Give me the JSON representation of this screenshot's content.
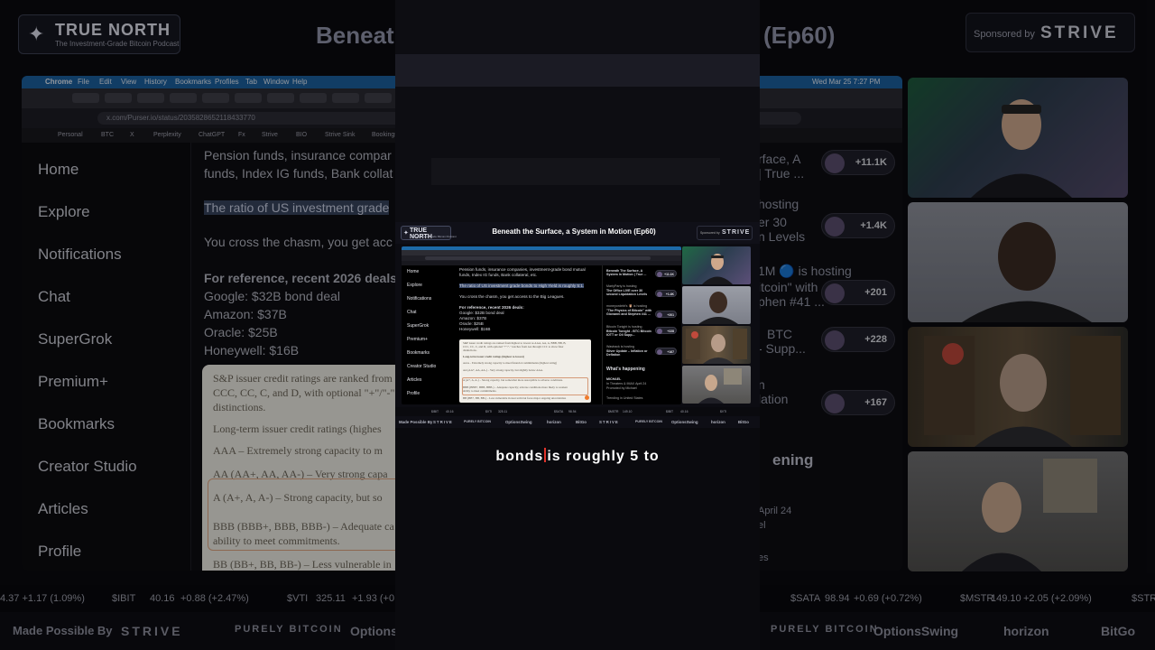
{
  "show": {
    "logo_title": "TRUE NORTH",
    "logo_subtitle": "The Investment-Grade Bitcoin Podcast",
    "episode_title": "Beneath the Surface, a System in Motion (Ep60)",
    "bg_title_left": "Beneath",
    "bg_title_right": "(Ep60)",
    "sponsored_by_label": "Sponsored by",
    "sponsor_brand": "STRIVE"
  },
  "browser": {
    "menu": [
      "Chrome",
      "File",
      "Edit",
      "View",
      "History",
      "Bookmarks",
      "Profiles",
      "Tab",
      "Window",
      "Help"
    ],
    "clock": "Wed Mar 25  7:27 PM",
    "url": "x.com/Purser.io/status/2035828652118433770",
    "bookmarks": [
      "Personal",
      "BTC",
      "X",
      "Perplexity",
      "ChatGPT",
      "Fx",
      "Strive",
      "BIO",
      "Strive Sink",
      "Bookings"
    ]
  },
  "sidebar": {
    "items": [
      "Home",
      "Explore",
      "Notifications",
      "Chat",
      "SuperGrok",
      "Premium+",
      "Bookmarks",
      "Creator Studio",
      "Articles",
      "Profile"
    ]
  },
  "post": {
    "line1": "Pension funds, insurance companies, investment-grade bond mutual",
    "line2": "funds, Index IG funds, Bank collateral, etc.",
    "highlight": "The ratio of US investment grade bonds to High Yield is roughly 5:1.",
    "chasm": "You cross the chasm, you get access to the Big Leagues.",
    "ref_heading": "For reference, recent 2026 deals:",
    "deals": [
      "Google: $32B bond deal",
      "Amazon: $37B",
      "Oracle: $25B",
      "Honeywell: $16B"
    ],
    "bg_line1": "Pension funds, insurance compar",
    "bg_line2": "funds, Index IG funds, Bank collat",
    "bg_highlight": "The ratio of US investment grade",
    "bg_chasm": "You cross the chasm, you get acc",
    "bg_ref_heading": "For reference, recent 2026 deals"
  },
  "ratings_card": {
    "intro1": "S&P issuer credit ratings are ranked from highest to lowest as AAA, AA, A, BBB, BB, B,",
    "intro2": "CCC, CC, C, and D, with optional \"+\"/\"-\" notches from AA through CCC to show finer",
    "intro3": "distinctions.",
    "heading": "Long-term issuer credit ratings (highest to lowest)",
    "aaa": "AAA – Extremely strong capacity to meet financial commitments (highest rating)",
    "aa": "AA (AA+, AA, AA-) – Very strong capacity, but slightly below AAA.",
    "a": "A (A+, A, A-) – Strong capacity, but somewhat more susceptible to adverse conditions.",
    "bbb": "BBB (BBB+, BBB, BBB-) – Adequate capacity; adverse conditions more likely to weaken",
    "bbb2": "ability to meet commitments.",
    "bb": "BB (BB+, BB, BB-) – Less vulnerable in near term but faces major ongoing uncertainties",
    "bg_intro1": "S&P issuer credit ratings are ranked from hi",
    "bg_intro2": "CCC, CC, C, and D, with optional \"+\"/\"-\" no",
    "bg_intro3": "distinctions.",
    "bg_heading": "Long-term issuer credit ratings (highes",
    "bg_aaa": "AAA – Extremely strong capacity to m",
    "bg_aa": "AA (AA+, AA, AA-) – Very strong capa",
    "bg_a": "A (A+, A, A-) – Strong capacity, but so",
    "bg_bbb": "BBB (BBB+, BBB, BBB-) – Adequate ca",
    "bg_bbb2": "ability to meet commitments.",
    "bg_bb": "BB (BB+, BB, BB-) – Less vulnerable in"
  },
  "right_panel": {
    "space1_title": "Beneath The Surface, A System In Motion | True ...",
    "space1_count": "+11.1K",
    "space2_host": "MartyParty is hosting",
    "space2_title": "The Office LIVE over 30 second Liquidation Levels",
    "space2_count": "+1.4K",
    "space3_host": "moneyordebt's 🦉 is hosting",
    "space3_title": "\"The Physics of Bitcoin\" with Giovanni and Stephen #41 ...",
    "space3_count": "+201",
    "space4_host": "Bitcoin Tonight is hosting",
    "space4_title": "Bitcoin Tonight - BTC Bitcoin IOTT or Oil Supp...",
    "space4_count": "+228",
    "space5_host": "Wastrack is hosting",
    "space5_title": "Silver Update – Inflation or Deflation",
    "space5_count": "+167",
    "whats_happening": "What's happening",
    "event_title": "MICHAEL",
    "event_meta": "In Theaters & IMAX April 24",
    "event_promo": "Promoted by Michael",
    "trending": "Trending in United States",
    "bg_title_a": "rface, A",
    "bg_title_b": "| True ...",
    "bg_hosting": "hosting",
    "bg_liq_a": "er 30",
    "bg_liq_b": "n Levels",
    "bg_hosting2": "1M 🔵 is hosting",
    "bg_phys_a": "itcoin\" with",
    "bg_phys_b": "phen #41 ...",
    "bg_btc_a": "BTC",
    "bg_btc_b": "- Supp...",
    "bg_infl_a": "n",
    "bg_infl_b": "lation",
    "bg_happening": "ening",
    "bg_april": "April 24",
    "bg_el": "el",
    "bg_es": "es"
  },
  "ticker": [
    {
      "sym": "$IBIT",
      "val": "40.16",
      "chg": "+0.88 (+2.47%)"
    },
    {
      "sym": "$VTI",
      "val": "325.11",
      "chg": "+1.93 (+0.61%)"
    },
    {
      "sym": "$SATA",
      "val": "98.94",
      "chg": "+0.69 (+0.72%)"
    },
    {
      "sym": "$MSTR",
      "val": "149.10",
      "chg": "+2.05 (+2.09%)"
    },
    {
      "sym": "$STR",
      "val": "",
      "chg": ""
    }
  ],
  "ticker_left_fragment": "4.37 +1.17 (1.09%)",
  "sponsors": {
    "label": "Made Possible By",
    "brands": [
      "STRIVE",
      "PURELY BITCOIN",
      "OptionsSwing",
      "horizon",
      "BitGo"
    ]
  },
  "caption": {
    "before": "bonds",
    "after": "is roughly 5  to"
  },
  "colors": {
    "accent_red": "#e0342b",
    "highlight_blue": "#3d4d6e",
    "card_bg": "#f1eee8"
  }
}
